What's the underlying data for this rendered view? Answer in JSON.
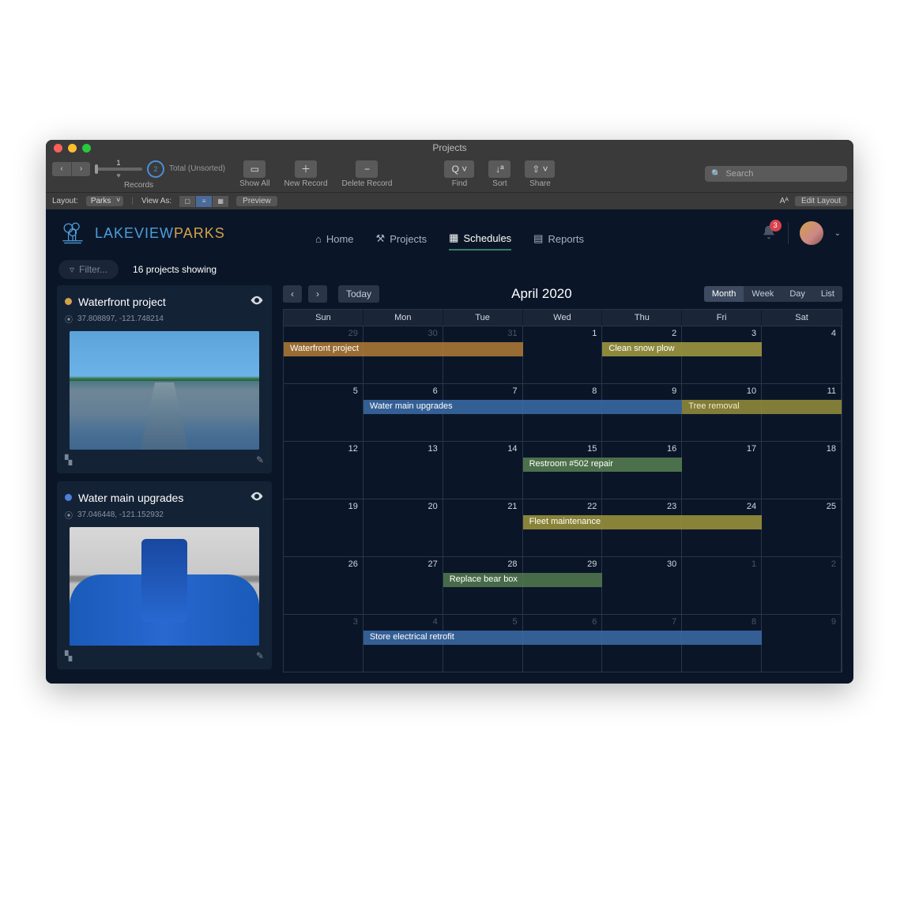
{
  "window": {
    "title": "Projects"
  },
  "toolbar": {
    "record_index": "1",
    "record_total": "2",
    "record_sort": "Total (Unsorted)",
    "group_records": "Records",
    "show_all": "Show All",
    "new_record": "New Record",
    "delete_record": "Delete Record",
    "find": "Find",
    "sort": "Sort",
    "share": "Share",
    "search_placeholder": "Search"
  },
  "statusbar": {
    "layout_label": "Layout:",
    "layout_value": "Parks",
    "view_as": "View As:",
    "preview": "Preview",
    "aa": "Aᴬ",
    "edit_layout": "Edit Layout"
  },
  "brand": {
    "lake": "LAKEVIEW",
    "parks": "PARKS"
  },
  "nav": {
    "home": "Home",
    "projects": "Projects",
    "schedules": "Schedules",
    "reports": "Reports"
  },
  "header": {
    "notif_count": "3"
  },
  "filter": {
    "placeholder": "Filter...",
    "showing": "16 projects showing"
  },
  "sidebar": {
    "cards": [
      {
        "title": "Waterfront project",
        "coords": "37.808897, -121.748214",
        "dot": "#d4a24a"
      },
      {
        "title": "Water main upgrades",
        "coords": "37.046448, -121.152932",
        "dot": "#4f7edb"
      }
    ]
  },
  "calendar": {
    "title": "April 2020",
    "today": "Today",
    "views": [
      "Month",
      "Week",
      "Day",
      "List"
    ],
    "active_view": "Month",
    "day_names": [
      "Sun",
      "Mon",
      "Tue",
      "Wed",
      "Thu",
      "Fri",
      "Sat"
    ],
    "weeks": [
      {
        "dates": [
          "29",
          "30",
          "31",
          "1",
          "2",
          "3",
          "4"
        ],
        "dim": [
          0,
          1,
          2
        ]
      },
      {
        "dates": [
          "5",
          "6",
          "7",
          "8",
          "9",
          "10",
          "11"
        ],
        "dim": []
      },
      {
        "dates": [
          "12",
          "13",
          "14",
          "15",
          "16",
          "17",
          "18"
        ],
        "dim": []
      },
      {
        "dates": [
          "19",
          "20",
          "21",
          "22",
          "23",
          "24",
          "25"
        ],
        "dim": []
      },
      {
        "dates": [
          "26",
          "27",
          "28",
          "29",
          "30",
          "1",
          "2"
        ],
        "dim": [
          5,
          6
        ]
      },
      {
        "dates": [
          "3",
          "4",
          "5",
          "6",
          "7",
          "8",
          "9"
        ],
        "dim": [
          0,
          1,
          2,
          3,
          4,
          5,
          6
        ]
      }
    ],
    "events": [
      {
        "week": 0,
        "start": 0,
        "span": 3,
        "label": "Waterfront project",
        "cls": "clr-orange"
      },
      {
        "week": 0,
        "start": 4,
        "span": 2,
        "label": "Clean snow plow",
        "cls": "clr-olive"
      },
      {
        "week": 1,
        "start": 1,
        "span": 4,
        "label": "Water main upgrades",
        "cls": "clr-blue"
      },
      {
        "week": 1,
        "start": 5,
        "span": 2,
        "label": "Tree removal",
        "cls": "clr-oliveb"
      },
      {
        "week": 2,
        "start": 3,
        "span": 2,
        "label": "Restroom #502 repair",
        "cls": "clr-green"
      },
      {
        "week": 3,
        "start": 3,
        "span": 3,
        "label": "Fleet maintenance",
        "cls": "clr-olive2"
      },
      {
        "week": 4,
        "start": 2,
        "span": 2,
        "label": "Replace bear box",
        "cls": "clr-green2"
      },
      {
        "week": 5,
        "start": 1,
        "span": 5,
        "label": "Store electrical retrofit",
        "cls": "clr-blue"
      }
    ]
  }
}
